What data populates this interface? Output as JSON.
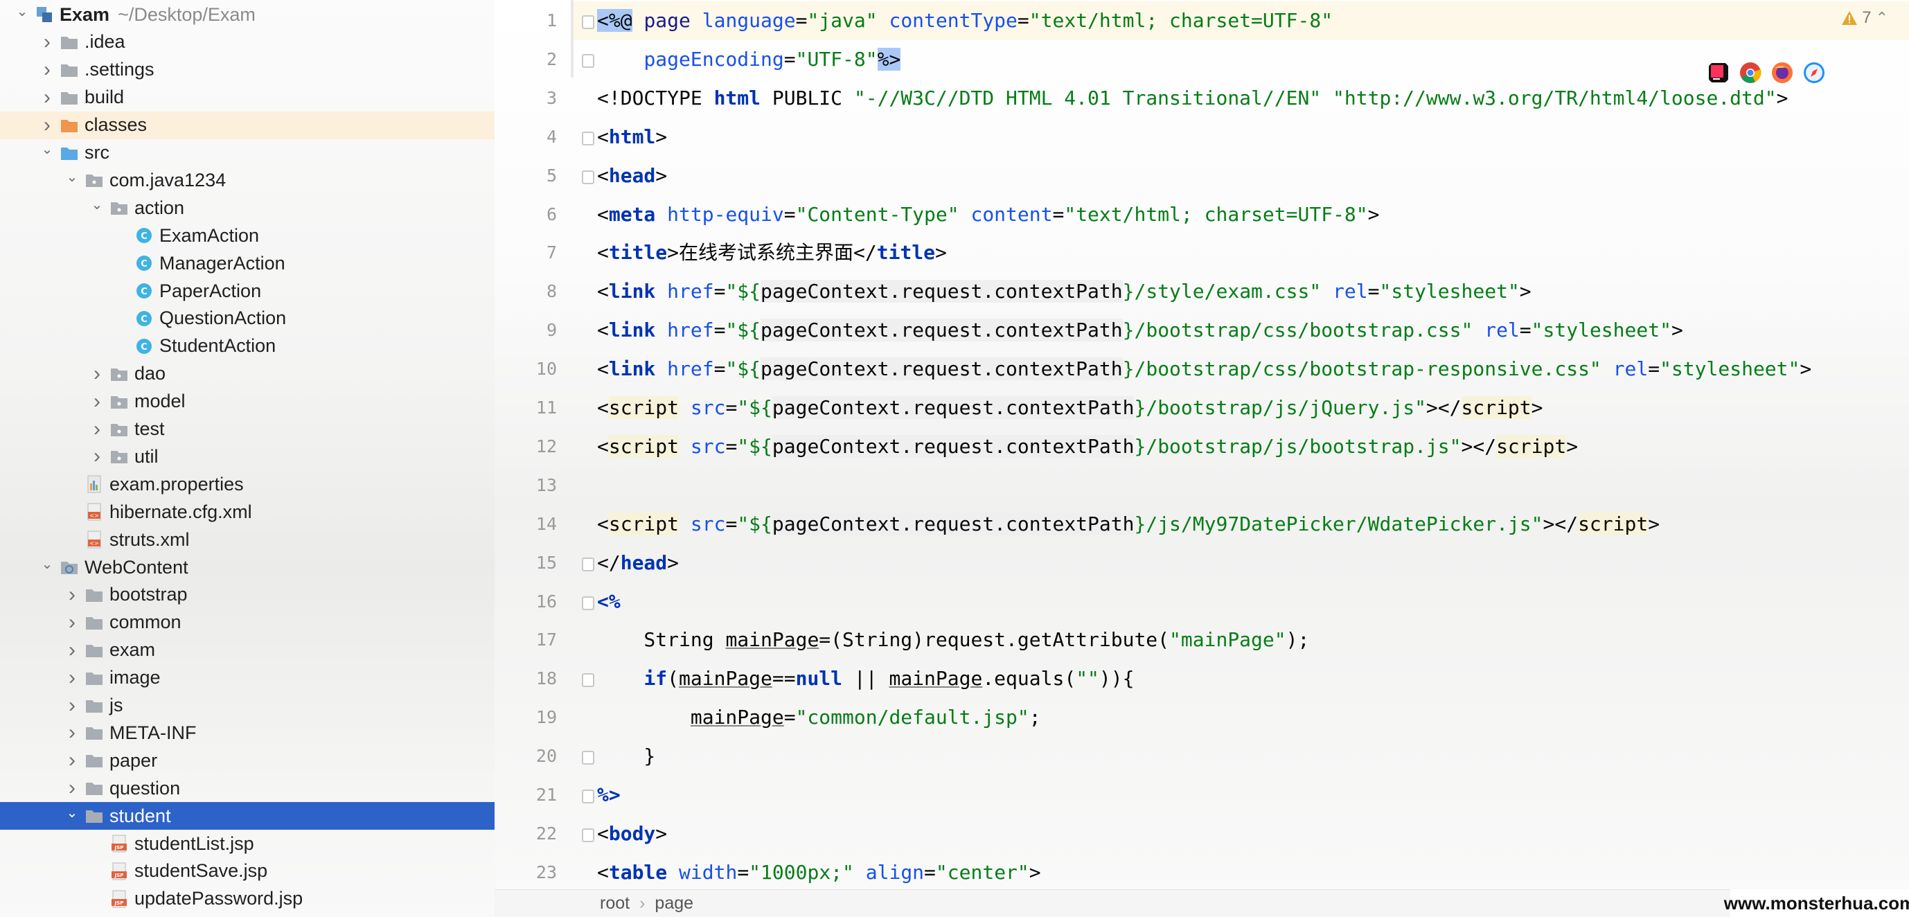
{
  "project": {
    "name": "Exam",
    "path": "~/Desktop/Exam"
  },
  "tree": [
    {
      "label": "Exam",
      "depth": 0,
      "type": "project",
      "expanded": true
    },
    {
      "label": ".idea",
      "depth": 1,
      "type": "folder",
      "expanded": false
    },
    {
      "label": ".settings",
      "depth": 1,
      "type": "folder",
      "expanded": false
    },
    {
      "label": "build",
      "depth": 1,
      "type": "folder",
      "expanded": false
    },
    {
      "label": "classes",
      "depth": 1,
      "type": "folder-excluded",
      "expanded": false
    },
    {
      "label": "src",
      "depth": 1,
      "type": "folder-source",
      "expanded": true
    },
    {
      "label": "com.java1234",
      "depth": 2,
      "type": "package",
      "expanded": true
    },
    {
      "label": "action",
      "depth": 3,
      "type": "package",
      "expanded": true
    },
    {
      "label": "ExamAction",
      "depth": 4,
      "type": "class"
    },
    {
      "label": "ManagerAction",
      "depth": 4,
      "type": "class"
    },
    {
      "label": "PaperAction",
      "depth": 4,
      "type": "class"
    },
    {
      "label": "QuestionAction",
      "depth": 4,
      "type": "class"
    },
    {
      "label": "StudentAction",
      "depth": 4,
      "type": "class"
    },
    {
      "label": "dao",
      "depth": 3,
      "type": "package",
      "expanded": false
    },
    {
      "label": "model",
      "depth": 3,
      "type": "package",
      "expanded": false
    },
    {
      "label": "test",
      "depth": 3,
      "type": "package",
      "expanded": false
    },
    {
      "label": "util",
      "depth": 3,
      "type": "package",
      "expanded": false
    },
    {
      "label": "exam.properties",
      "depth": 2,
      "type": "properties"
    },
    {
      "label": "hibernate.cfg.xml",
      "depth": 2,
      "type": "xml"
    },
    {
      "label": "struts.xml",
      "depth": 2,
      "type": "xml"
    },
    {
      "label": "WebContent",
      "depth": 1,
      "type": "folder-web",
      "expanded": true
    },
    {
      "label": "bootstrap",
      "depth": 2,
      "type": "folder",
      "expanded": false
    },
    {
      "label": "common",
      "depth": 2,
      "type": "folder",
      "expanded": false
    },
    {
      "label": "exam",
      "depth": 2,
      "type": "folder",
      "expanded": false
    },
    {
      "label": "image",
      "depth": 2,
      "type": "folder",
      "expanded": false
    },
    {
      "label": "js",
      "depth": 2,
      "type": "folder",
      "expanded": false
    },
    {
      "label": "META-INF",
      "depth": 2,
      "type": "folder",
      "expanded": false
    },
    {
      "label": "paper",
      "depth": 2,
      "type": "folder",
      "expanded": false
    },
    {
      "label": "question",
      "depth": 2,
      "type": "folder",
      "expanded": false
    },
    {
      "label": "student",
      "depth": 2,
      "type": "folder",
      "expanded": true,
      "selected": true
    },
    {
      "label": "studentList.jsp",
      "depth": 3,
      "type": "jsp"
    },
    {
      "label": "studentSave.jsp",
      "depth": 3,
      "type": "jsp"
    },
    {
      "label": "updatePassword.jsp",
      "depth": 3,
      "type": "jsp"
    }
  ],
  "editor": {
    "line_numbers": [
      "1",
      "2",
      "3",
      "4",
      "5",
      "6",
      "7",
      "8",
      "9",
      "10",
      "11",
      "12",
      "13",
      "14",
      "15",
      "16",
      "17",
      "18",
      "19",
      "20",
      "21",
      "22",
      "23"
    ],
    "warning_count": "7",
    "warning_icon": "warning-triangle-icon",
    "browser_icons": [
      "intellij-icon",
      "chrome-icon",
      "firefox-icon",
      "safari-icon"
    ],
    "lines": [
      [
        [
          "jsp",
          "<%@"
        ],
        [
          "pl",
          " "
        ],
        [
          "tg",
          "page"
        ],
        [
          "pl",
          " "
        ],
        [
          "at",
          "language"
        ],
        [
          "pl",
          "="
        ],
        [
          "st",
          "\"java\""
        ],
        [
          "pl",
          " "
        ],
        [
          "at",
          "contentType"
        ],
        [
          "pl",
          "="
        ],
        [
          "st",
          "\"text/html; charset=UTF-8\""
        ]
      ],
      [
        [
          "pl",
          "    "
        ],
        [
          "at",
          "pageEncoding"
        ],
        [
          "pl",
          "="
        ],
        [
          "st",
          "\"UTF-8\""
        ],
        [
          "jsp",
          "%>"
        ]
      ],
      [
        [
          "pl",
          "<!DOCTYPE "
        ],
        [
          "kw",
          "html"
        ],
        [
          "pl",
          " PUBLIC "
        ],
        [
          "st",
          "\"-//W3C//DTD HTML 4.01 Transitional//EN\""
        ],
        [
          "pl",
          " "
        ],
        [
          "st",
          "\"http://www.w3.org/TR/html4/loose.dtd\""
        ],
        [
          "pl",
          ">"
        ]
      ],
      [
        [
          "pl",
          "<"
        ],
        [
          "kw",
          "html"
        ],
        [
          "pl",
          ">"
        ]
      ],
      [
        [
          "pl",
          "<"
        ],
        [
          "kw",
          "head"
        ],
        [
          "pl",
          ">"
        ]
      ],
      [
        [
          "pl",
          "<"
        ],
        [
          "kw",
          "meta"
        ],
        [
          "pl",
          " "
        ],
        [
          "at",
          "http-equiv"
        ],
        [
          "pl",
          "="
        ],
        [
          "st",
          "\"Content-Type\""
        ],
        [
          "pl",
          " "
        ],
        [
          "at",
          "content"
        ],
        [
          "pl",
          "="
        ],
        [
          "st",
          "\"text/html; charset=UTF-8\""
        ],
        [
          "pl",
          ">"
        ]
      ],
      [
        [
          "pl",
          "<"
        ],
        [
          "kw",
          "title"
        ],
        [
          "pl",
          ">在线考试系统主界面</"
        ],
        [
          "kw",
          "title"
        ],
        [
          "pl",
          ">"
        ]
      ],
      [
        [
          "pl",
          "<"
        ],
        [
          "kw",
          "link"
        ],
        [
          "pl",
          " "
        ],
        [
          "at",
          "href"
        ],
        [
          "pl",
          "="
        ],
        [
          "st",
          "\"${"
        ],
        [
          "el",
          "pageContext.request.contextPath"
        ],
        [
          "st",
          "}/style/exam.css\""
        ],
        [
          "pl",
          " "
        ],
        [
          "at",
          "rel"
        ],
        [
          "pl",
          "="
        ],
        [
          "st",
          "\"stylesheet\""
        ],
        [
          "pl",
          ">"
        ]
      ],
      [
        [
          "pl",
          "<"
        ],
        [
          "kw",
          "link"
        ],
        [
          "pl",
          " "
        ],
        [
          "at",
          "href"
        ],
        [
          "pl",
          "="
        ],
        [
          "st",
          "\"${"
        ],
        [
          "el",
          "pageContext.request.contextPath"
        ],
        [
          "st",
          "}/bootstrap/css/bootstrap.css\""
        ],
        [
          "pl",
          " "
        ],
        [
          "at",
          "rel"
        ],
        [
          "pl",
          "="
        ],
        [
          "st",
          "\"stylesheet\""
        ],
        [
          "pl",
          ">"
        ]
      ],
      [
        [
          "pl",
          "<"
        ],
        [
          "kw",
          "link"
        ],
        [
          "pl",
          " "
        ],
        [
          "at",
          "href"
        ],
        [
          "pl",
          "="
        ],
        [
          "st",
          "\"${"
        ],
        [
          "el",
          "pageContext.request.contextPath"
        ],
        [
          "st",
          "}/bootstrap/css/bootstrap-responsive.css\""
        ],
        [
          "pl",
          " "
        ],
        [
          "at",
          "rel"
        ],
        [
          "pl",
          "="
        ],
        [
          "st",
          "\"stylesheet\""
        ],
        [
          "pl",
          ">"
        ]
      ],
      [
        [
          "pl",
          "<"
        ],
        [
          "tgb",
          "script"
        ],
        [
          "pl",
          " "
        ],
        [
          "at",
          "src"
        ],
        [
          "pl",
          "="
        ],
        [
          "st",
          "\"${"
        ],
        [
          "el",
          "pageContext.request.contextPath"
        ],
        [
          "st",
          "}/bootstrap/js/jQuery.js\""
        ],
        [
          "pl",
          "></"
        ],
        [
          "tgb",
          "script"
        ],
        [
          "pl",
          ">"
        ]
      ],
      [
        [
          "pl",
          "<"
        ],
        [
          "tgb",
          "script"
        ],
        [
          "pl",
          " "
        ],
        [
          "at",
          "src"
        ],
        [
          "pl",
          "="
        ],
        [
          "st",
          "\"${"
        ],
        [
          "el",
          "pageContext.request.contextPath"
        ],
        [
          "st",
          "}/bootstrap/js/bootstrap.js\""
        ],
        [
          "pl",
          "></"
        ],
        [
          "tgb",
          "script"
        ],
        [
          "pl",
          ">"
        ]
      ],
      [
        [
          "pl",
          ""
        ]
      ],
      [
        [
          "pl",
          "<"
        ],
        [
          "tgb",
          "script"
        ],
        [
          "pl",
          " "
        ],
        [
          "at",
          "src"
        ],
        [
          "pl",
          "="
        ],
        [
          "st",
          "\"${"
        ],
        [
          "el",
          "pageContext.request.contextPath"
        ],
        [
          "st",
          "}/js/My97DatePicker/WdatePicker.js\""
        ],
        [
          "pl",
          "></"
        ],
        [
          "tgb",
          "script"
        ],
        [
          "pl",
          ">"
        ]
      ],
      [
        [
          "pl",
          "</"
        ],
        [
          "kw",
          "head"
        ],
        [
          "pl",
          ">"
        ]
      ],
      [
        [
          "kw",
          "<%"
        ]
      ],
      [
        [
          "pl",
          "    String "
        ],
        [
          "vu",
          "mainPage"
        ],
        [
          "pl",
          "=(String)request.getAttribute("
        ],
        [
          "st",
          "\"mainPage\""
        ],
        [
          "pl",
          ");"
        ]
      ],
      [
        [
          "pl",
          "    "
        ],
        [
          "kw",
          "if"
        ],
        [
          "pl",
          "("
        ],
        [
          "vu",
          "mainPage"
        ],
        [
          "pl",
          "=="
        ],
        [
          "kw",
          "null"
        ],
        [
          "pl",
          " || "
        ],
        [
          "vu",
          "mainPage"
        ],
        [
          "pl",
          ".equals("
        ],
        [
          "st",
          "\"\""
        ],
        [
          "pl",
          ")){"
        ]
      ],
      [
        [
          "pl",
          "        "
        ],
        [
          "vu",
          "mainPage"
        ],
        [
          "pl",
          "="
        ],
        [
          "st",
          "\"common/default.jsp\""
        ],
        [
          "pl",
          ";"
        ]
      ],
      [
        [
          "pl",
          "    }"
        ]
      ],
      [
        [
          "kw",
          "%>"
        ]
      ],
      [
        [
          "pl",
          "<"
        ],
        [
          "kw",
          "body"
        ],
        [
          "pl",
          ">"
        ]
      ],
      [
        [
          "pl",
          "<"
        ],
        [
          "kw",
          "table"
        ],
        [
          "pl",
          " "
        ],
        [
          "at",
          "width"
        ],
        [
          "pl",
          "="
        ],
        [
          "st",
          "\"1000px;\""
        ],
        [
          "pl",
          " "
        ],
        [
          "at",
          "align"
        ],
        [
          "pl",
          "="
        ],
        [
          "st",
          "\"center\""
        ],
        [
          "pl",
          ">"
        ]
      ]
    ]
  },
  "breadcrumb": [
    "root",
    "page"
  ],
  "watermark": "www.monsterhua.com"
}
